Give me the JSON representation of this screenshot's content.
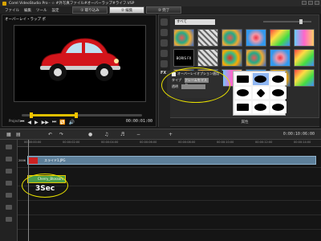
{
  "window": {
    "title": "Corel VideoStudio Pro - ☆ #外写真ファイル#オーバーラップ#ライフ.VSP"
  },
  "menu": [
    "ファイル",
    "編集",
    "ツール",
    "設定"
  ],
  "steps": [
    {
      "label": "① 取り込み",
      "active": false
    },
    {
      "label": "② 編集",
      "active": true
    },
    {
      "label": "③ 完了",
      "active": false
    }
  ],
  "player": {
    "clip_label": "オーバーレイ・ラップ ポ",
    "mode_label": "Project",
    "timecode": "00:00:01:00",
    "controls": [
      "⏮",
      "◀",
      "▶",
      "▶▶",
      "⏭",
      "🔁",
      "🔊"
    ]
  },
  "library": {
    "category": "すべて",
    "thumbnails": [
      {
        "label": "",
        "text": ""
      },
      {
        "label": "",
        "text": ""
      },
      {
        "label": "",
        "text": ""
      },
      {
        "label": "",
        "text": ""
      },
      {
        "label": "",
        "text": ""
      },
      {
        "label": "",
        "text": ""
      },
      {
        "label": "",
        "text": "BORIS FX"
      },
      {
        "label": "",
        "text": ""
      },
      {
        "label": "",
        "text": ""
      },
      {
        "label": "",
        "text": ""
      },
      {
        "label": "",
        "text": ""
      },
      {
        "label": "",
        "text": ""
      },
      {
        "label": "",
        "text": ""
      },
      {
        "label": "",
        "text": ""
      },
      {
        "label": "",
        "text": ""
      },
      {
        "label": "",
        "text": ""
      },
      {
        "label": "",
        "text": ""
      },
      {
        "label": "",
        "text": ""
      }
    ],
    "options": {
      "overlay_option_label": "オーバーレイオプション適用",
      "type_label": "タイプ",
      "type_value": "フレームをマスク",
      "mask_label": "透明"
    },
    "bottom_label": "属性"
  },
  "timeline": {
    "timecode": "0:00:10:06:00",
    "ruler": [
      "00:00:00:00",
      "00:00:02:00",
      "00:00:04:00",
      "00:00:06:00",
      "00:00:08:00",
      "00:00:10:00",
      "00:00:12:00",
      "00:00:14:00"
    ],
    "video_clip_name": "スライド1.JPG",
    "video_track_label": "2006",
    "overlay_clip_name": "Cherry_Blossom",
    "callout": "3Sec"
  },
  "colors": {
    "accent": "#e5c500",
    "car": "#d3151b",
    "video_clip": "#5d7f99",
    "overlay_clip": "#4a9e4a"
  }
}
